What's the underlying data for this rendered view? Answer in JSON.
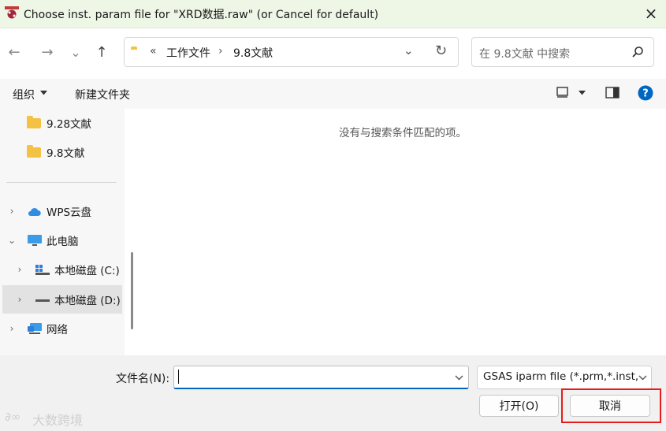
{
  "window": {
    "title": "Choose inst. param file for \"XRD数据.raw\" (or Cancel for default)",
    "close_icon": "×"
  },
  "nav": {
    "back_icon": "←",
    "forward_icon": "→",
    "recent_icon": "⌄",
    "up_icon": "↑",
    "breadcrumb_prefix": "«",
    "breadcrumb": [
      "工作文件",
      "9.8文献"
    ],
    "breadcrumb_sep": "›",
    "refresh_icon": "↻",
    "search_placeholder": "在 9.8文献 中搜索"
  },
  "toolbar": {
    "organize": "组织",
    "new_folder": "新建文件夹"
  },
  "sidebar": {
    "folders": [
      "9.28文献",
      "9.8文献"
    ],
    "items": [
      {
        "label": "WPS云盘",
        "chevron": "›"
      },
      {
        "label": "此电脑",
        "chevron": "⌄"
      },
      {
        "label": "本地磁盘 (C:)",
        "chevron": "›"
      },
      {
        "label": "本地磁盘 (D:)",
        "chevron": "›"
      },
      {
        "label": "网络",
        "chevron": "›"
      }
    ]
  },
  "content": {
    "empty_message": "没有与搜索条件匹配的项。"
  },
  "bottom": {
    "filename_label": "文件名(N):",
    "filename_value": "",
    "filter_value": "GSAS iparm file (*.prm,*.inst,",
    "open_button": "打开(O)",
    "cancel_button": "取消"
  },
  "watermark": "大数跨境",
  "colors": {
    "accent": "#0067c0",
    "highlight": "#e81c1c",
    "titlebar": "#eef6e6"
  }
}
